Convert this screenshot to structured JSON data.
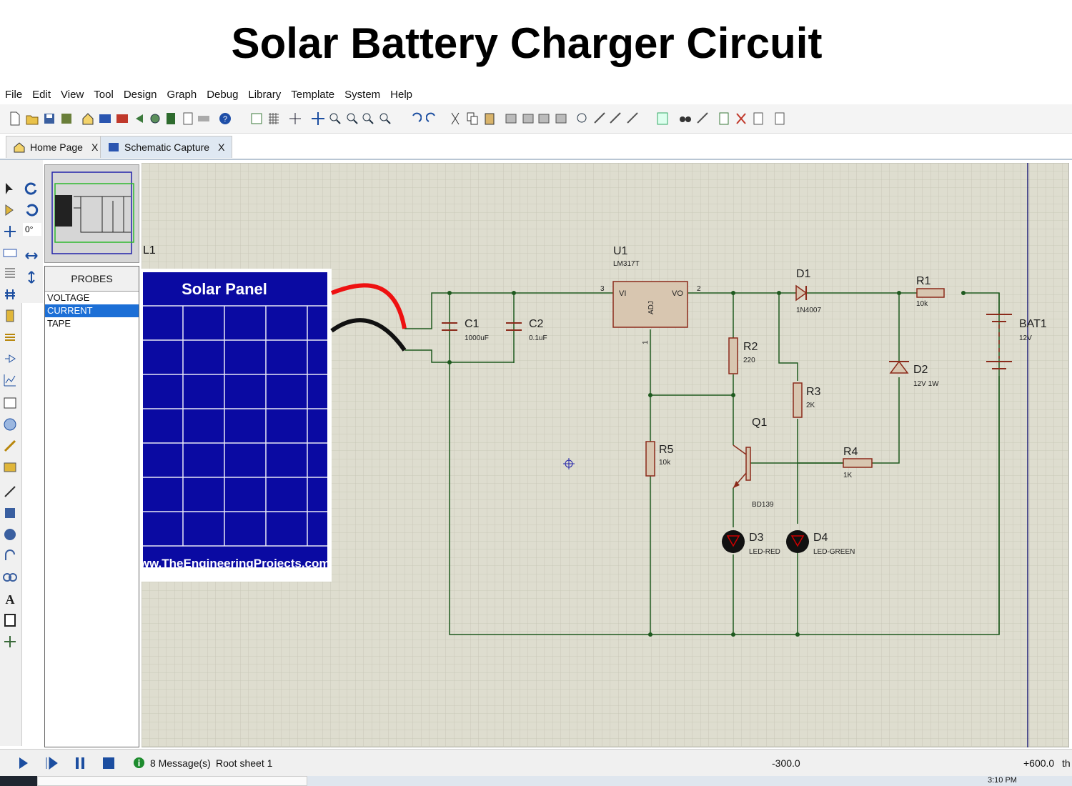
{
  "slide_title": "Solar Battery Charger Circuit",
  "menu": [
    "File",
    "Edit",
    "View",
    "Tool",
    "Design",
    "Graph",
    "Debug",
    "Library",
    "Template",
    "System",
    "Help"
  ],
  "tabs": [
    {
      "label": "Home Page",
      "close": "X"
    },
    {
      "label": "Schematic Capture",
      "close": "X"
    }
  ],
  "rotation_value": "0°",
  "probes": {
    "header": "PROBES",
    "items": [
      "VOLTAGE",
      "CURRENT",
      "TAPE"
    ],
    "selected": "CURRENT"
  },
  "schematic": {
    "partial_label": "L1",
    "solar_panel": {
      "title": "Solar Panel",
      "watermark": "www.TheEngineeringProjects.com"
    },
    "components": {
      "u1_ref": "U1",
      "u1_val": "LM317T",
      "u1_vi": "VI",
      "u1_vo": "VO",
      "u1_adj": "ADJ",
      "u1_pin3": "3",
      "u1_pin2": "2",
      "u1_pin1": "1",
      "c1_ref": "C1",
      "c1_val": "1000uF",
      "c2_ref": "C2",
      "c2_val": "0.1uF",
      "d1_ref": "D1",
      "d1_val": "1N4007",
      "r1_ref": "R1",
      "r1_val": "10k",
      "bat1_ref": "BAT1",
      "bat1_val": "12V",
      "d2_ref": "D2",
      "d2_val": "12V 1W",
      "r2_ref": "R2",
      "r2_val": "220",
      "r3_ref": "R3",
      "r3_val": "2K",
      "q1_ref": "Q1",
      "q1_val": "BD139",
      "r4_ref": "R4",
      "r4_val": "1K",
      "r5_ref": "R5",
      "r5_val": "10k",
      "d3_ref": "D3",
      "d3_val": "LED-RED",
      "d4_ref": "D4",
      "d4_val": "LED-GREEN"
    }
  },
  "status": {
    "messages": "8 Message(s)",
    "sheet": "Root sheet 1",
    "coord_x": "-300.0",
    "coord_y": "+600.0",
    "suffix": "th"
  },
  "clock": "3:10 PM",
  "colors": {
    "wire": "#1f5a1f",
    "component": "#8b2a1a",
    "grid": "#c9c9bd",
    "canvas_bg": "#deddcf",
    "panel_blue": "#0a0aa2"
  }
}
